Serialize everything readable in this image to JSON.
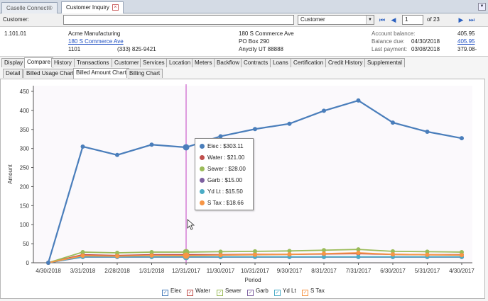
{
  "top_tabs": [
    {
      "label": "Caselle Connect®"
    },
    {
      "label": "Customer Inquiry"
    }
  ],
  "search": {
    "customer_label": "Customer:",
    "customer_value": "",
    "type_selected": "Customer",
    "page_value": "1",
    "page_of": "of 23"
  },
  "account": {
    "number": "1.101.01",
    "name": "Acme Manufacturing",
    "service_address": "180 S Commerce Ave",
    "id": "1101",
    "phone": "(333) 825-9421",
    "mail_line1": "180 S Commerce Ave",
    "mail_line2": "PO Box 290",
    "mail_line3": "Anycity  UT  88888",
    "balance_label": "Account balance:",
    "balance_value": "405.95",
    "due_label": "Balance due:",
    "due_date": "04/30/2018",
    "due_value": "405.95",
    "last_payment_label": "Last payment:",
    "last_payment_date": "03/08/2018",
    "last_payment_value": "379.08-"
  },
  "tabs": [
    "Display",
    "Compare",
    "History",
    "Transactions",
    "Customer",
    "Services",
    "Location",
    "Meters",
    "Backflow",
    "Contracts",
    "Loans",
    "Certification",
    "Credit History",
    "Supplemental"
  ],
  "subtabs": [
    "Detail",
    "Billed Usage Chart",
    "Billed Amount Chart",
    "Billing Chart"
  ],
  "tooltip": [
    {
      "text": "Elec : $303.11",
      "color": "#4a7ebb"
    },
    {
      "text": "Water : $21.00",
      "color": "#c0504d"
    },
    {
      "text": "Sewer : $28.00",
      "color": "#9bbb59"
    },
    {
      "text": "Garb : $15.00",
      "color": "#7d60a0"
    },
    {
      "text": "Yd Lt : $15.50",
      "color": "#4bacc6"
    },
    {
      "text": "S Tax : $18.66",
      "color": "#f79646"
    }
  ],
  "legend": [
    {
      "label": "Elec",
      "color": "#4a7ebb"
    },
    {
      "label": "Water",
      "color": "#c0504d"
    },
    {
      "label": "Sewer",
      "color": "#9bbb59"
    },
    {
      "label": "Garb",
      "color": "#7d60a0"
    },
    {
      "label": "Yd Lt",
      "color": "#4bacc6"
    },
    {
      "label": "S Tax",
      "color": "#f79646"
    }
  ],
  "chart_data": {
    "type": "line",
    "xlabel": "Period",
    "ylabel": "Amount",
    "ylim": [
      0,
      450
    ],
    "yticks": [
      0,
      50,
      100,
      150,
      200,
      250,
      300,
      350,
      400,
      450
    ],
    "categories": [
      "4/30/2018",
      "3/31/2018",
      "2/28/2018",
      "1/31/2018",
      "12/31/2017",
      "11/30/2017",
      "10/31/2017",
      "9/30/2017",
      "8/31/2017",
      "7/31/2017",
      "6/30/2017",
      "5/31/2017",
      "4/30/2017"
    ],
    "series": [
      {
        "name": "Elec",
        "color": "#4a7ebb",
        "values": [
          0,
          305,
          283,
          310,
          303.11,
          332,
          351,
          365,
          399,
          426,
          368,
          344,
          327
        ]
      },
      {
        "name": "Water",
        "color": "#c0504d",
        "values": [
          0,
          21,
          19,
          21,
          21,
          21,
          22,
          22,
          23,
          24,
          22,
          21,
          21
        ]
      },
      {
        "name": "Sewer",
        "color": "#9bbb59",
        "values": [
          0,
          28,
          26,
          28,
          28,
          29,
          30,
          31,
          33,
          35,
          30,
          29,
          28
        ]
      },
      {
        "name": "Garb",
        "color": "#7d60a0",
        "values": [
          0,
          15,
          15,
          15,
          15,
          15,
          15,
          15,
          15,
          15,
          15,
          15,
          15
        ]
      },
      {
        "name": "Yd Lt",
        "color": "#4bacc6",
        "values": [
          0,
          15.5,
          15.5,
          15.5,
          15.5,
          15.5,
          15.5,
          15.5,
          15.5,
          15.5,
          15.5,
          15.5,
          15.5
        ]
      },
      {
        "name": "S Tax",
        "color": "#f79646",
        "values": [
          0,
          18.5,
          17.5,
          19,
          18.66,
          20,
          21,
          22,
          24,
          26,
          22,
          21,
          20
        ]
      }
    ],
    "cursor_category": "12/31/2017",
    "grid": false,
    "legend_position": "bottom"
  }
}
